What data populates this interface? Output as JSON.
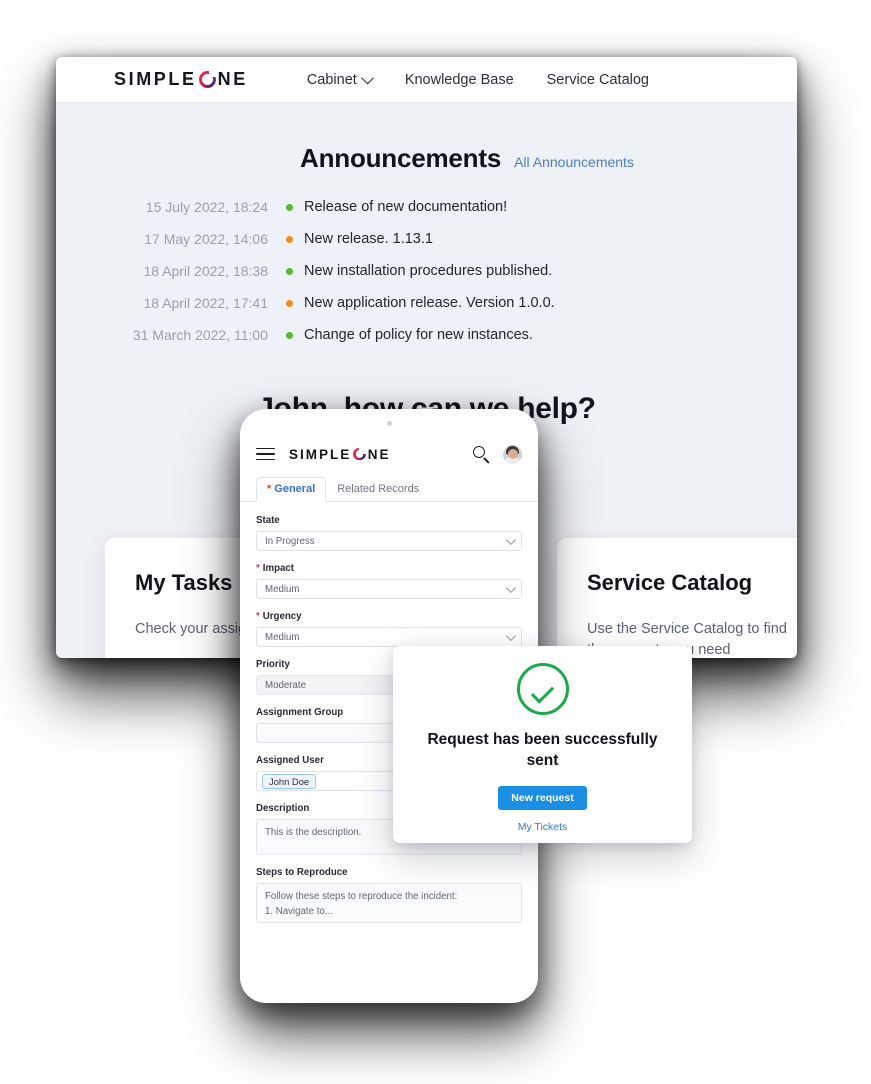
{
  "browser": {
    "logo": {
      "text_before": "SIMPLE",
      "text_after": "NE",
      "icon": "simpleone-ring-logo"
    },
    "nav": [
      {
        "label": "Cabinet",
        "has_chevron": true,
        "icon": "chevron-down-icon"
      },
      {
        "label": "Knowledge Base",
        "has_chevron": false
      },
      {
        "label": "Service Catalog",
        "has_chevron": false
      }
    ],
    "announcements": {
      "title": "Announcements",
      "link": "All Announcements",
      "items": [
        {
          "date": "15 July 2022, 18:24",
          "text": "Release of new documentation!",
          "status_color": "#5bb335"
        },
        {
          "date": "17 May 2022, 14:06",
          "text": "New release. 1.13.1",
          "status_color": "#f08c1e"
        },
        {
          "date": "18 April 2022, 18:38",
          "text": "New installation procedures published.",
          "status_color": "#5bb335"
        },
        {
          "date": "18 April 2022, 17:41",
          "text": "New application release. Version 1.0.0.",
          "status_color": "#f08c1e"
        },
        {
          "date": "31 March 2022, 11:00",
          "text": "Change of policy for new instances.",
          "status_color": "#5bb335"
        }
      ]
    },
    "hero": "John, how can we help?",
    "cards": [
      {
        "title": "My Tasks",
        "text": "Check your assig"
      },
      {
        "title": "Service Catalog",
        "text": "Use the Service Catalog to find the requests you need"
      }
    ]
  },
  "phone": {
    "logo": {
      "text_before": "SIMPLE",
      "text_after": "NE"
    },
    "icons": {
      "menu": "hamburger-menu-icon",
      "search": "search-icon",
      "avatar": "user-avatar"
    },
    "tabs": [
      {
        "label": "General",
        "required": true,
        "active": true
      },
      {
        "label": "Related Records",
        "required": false,
        "active": false
      }
    ],
    "fields": [
      {
        "label": "State",
        "required": false,
        "value": "In Progress",
        "type": "select"
      },
      {
        "label": "Impact",
        "required": true,
        "value": "Medium",
        "type": "select"
      },
      {
        "label": "Urgency",
        "required": true,
        "value": "Medium",
        "type": "select"
      },
      {
        "label": "Priority",
        "required": false,
        "value": "Moderate",
        "type": "readonly"
      },
      {
        "label": "Assignment Group",
        "required": false,
        "value": "",
        "type": "text"
      },
      {
        "label": "Assigned User",
        "required": false,
        "value": "John Doe",
        "type": "chip"
      },
      {
        "label": "Description",
        "required": false,
        "value": "This is the description.",
        "type": "textarea"
      },
      {
        "label": "Steps to Reproduce",
        "required": false,
        "value": "Follow these steps to reproduce the incident:\n1. Navigate to...",
        "type": "textarea"
      }
    ]
  },
  "dialog": {
    "icon": "success-check-circle-icon",
    "title": "Request has been successfully sent",
    "primary_button": "New request",
    "link": "My Tickets",
    "accent_color": "#17ab4a",
    "button_color": "#1a8fe3"
  }
}
